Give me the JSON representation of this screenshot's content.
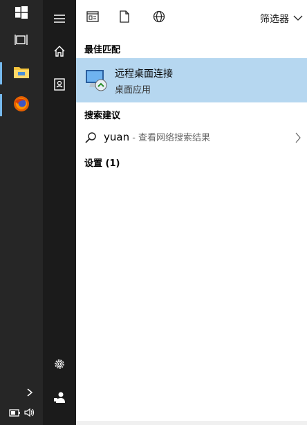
{
  "panel": {
    "filter_label": "筛选器",
    "best_match_heading": "最佳匹配",
    "best_match": {
      "title": "远程桌面连接",
      "subtitle": "桌面应用"
    },
    "search_suggest_heading": "搜索建议",
    "suggestion": {
      "query": "yuan",
      "hint": " - 查看网络搜索结果"
    },
    "settings_heading": "设置 (1)"
  },
  "colors": {
    "taskbar": "#262626",
    "rail": "#1b1b1b",
    "selected_row": "#b6d7f0",
    "pinned_indicator": "#76b9ed"
  },
  "icons": {
    "taskbar": [
      "windows-logo-icon",
      "task-view-icon",
      "file-explorer-icon",
      "firefox-icon"
    ],
    "rail": [
      "hamburger-menu-icon",
      "home-icon",
      "contact-card-icon",
      "settings-gear-icon",
      "user-icon"
    ],
    "toolbar": [
      "apps-icon",
      "documents-icon",
      "web-icon"
    ],
    "tray": [
      "chevron-up-icon",
      "battery-icon",
      "volume-icon"
    ]
  }
}
